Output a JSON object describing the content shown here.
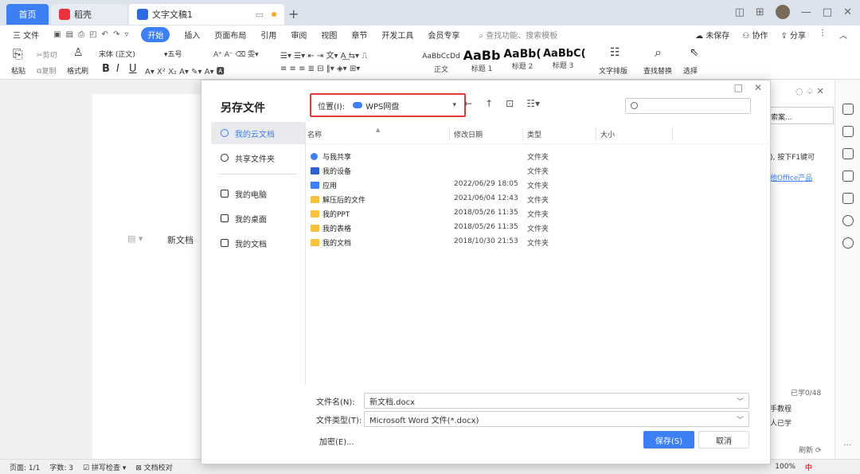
{
  "titlebar": {
    "tab_home": "首页",
    "tab_daoke": "稻壳",
    "tab_doc": "文字文稿1",
    "add_tab": "+"
  },
  "menubar": {
    "file": "三 文件",
    "items": [
      "开始",
      "插入",
      "页面布局",
      "引用",
      "审阅",
      "视图",
      "章节",
      "开发工具",
      "会员专享"
    ],
    "search": "查找功能、搜索模板",
    "unsaved": "未保存",
    "collab": "协作",
    "share": "分享"
  },
  "ribbon": {
    "paste": "粘贴",
    "cut": "剪切",
    "copy": "复制",
    "format_painter": "格式刷",
    "font_name": "宋体 (正文)",
    "font_size": "五号",
    "bold": "B",
    "italic": "I",
    "underline": "U",
    "styles": [
      {
        "preview": "AaBbCcDd",
        "name": "正文"
      },
      {
        "preview": "AaBb",
        "name": "标题 1"
      },
      {
        "preview": "AaBb(",
        "name": "标题 2"
      },
      {
        "preview": "AaBbC(",
        "name": "标题 3"
      }
    ],
    "text_layout": "文字排版",
    "find_replace": "查找替换",
    "select": "选择"
  },
  "document": {
    "text": "新文档"
  },
  "right_panel": {
    "search_hint": "索案...",
    "f1_hint": "), 按下F1键可",
    "office_link": "他Office产品",
    "learned": "已学0/48",
    "tutorial": "手教程",
    "people": "人已学",
    "refresh": "刷新"
  },
  "statusbar": {
    "page": "页面: 1/1",
    "wordcount": "字数: 3",
    "spellcheck": "拼写检查",
    "proofread": "文档校对",
    "zoom": "100%",
    "ime": "中"
  },
  "dialog": {
    "title": "另存文件",
    "location_label": "位置(I):",
    "location_value": "WPS网盘",
    "nav": [
      {
        "label": "我的云文档",
        "active": true
      },
      {
        "label": "共享文件夹",
        "active": false
      },
      {
        "label": "我的电脑",
        "active": false
      },
      {
        "label": "我的桌面",
        "active": false
      },
      {
        "label": "我的文档",
        "active": false
      }
    ],
    "columns": {
      "name": "名称",
      "date": "修改日期",
      "type": "类型",
      "size": "大小"
    },
    "files": [
      {
        "name": "与我共享",
        "date": "",
        "type": "文件夹",
        "icon": "share"
      },
      {
        "name": "我的设备",
        "date": "",
        "type": "文件夹",
        "icon": "device"
      },
      {
        "name": "应用",
        "date": "2022/06/29 18:05",
        "type": "文件夹",
        "icon": "app"
      },
      {
        "name": "解压后的文件",
        "date": "2021/06/04 12:43",
        "type": "文件夹",
        "icon": "folder"
      },
      {
        "name": "我的PPT",
        "date": "2018/05/26 11:35",
        "type": "文件夹",
        "icon": "folder"
      },
      {
        "name": "我的表格",
        "date": "2018/05/26 11:35",
        "type": "文件夹",
        "icon": "folder"
      },
      {
        "name": "我的文档",
        "date": "2018/10/30 21:53",
        "type": "文件夹",
        "icon": "folder"
      }
    ],
    "filename_label": "文件名(N):",
    "filename_value": "新文档.docx",
    "filetype_label": "文件类型(T):",
    "filetype_value": "Microsoft Word 文件(*.docx)",
    "encrypt": "加密(E)...",
    "save": "保存(S)",
    "cancel": "取消"
  },
  "colors": {
    "accent": "#3d7ff5",
    "highlight_border": "#e53935",
    "folder": "#f5c242"
  }
}
